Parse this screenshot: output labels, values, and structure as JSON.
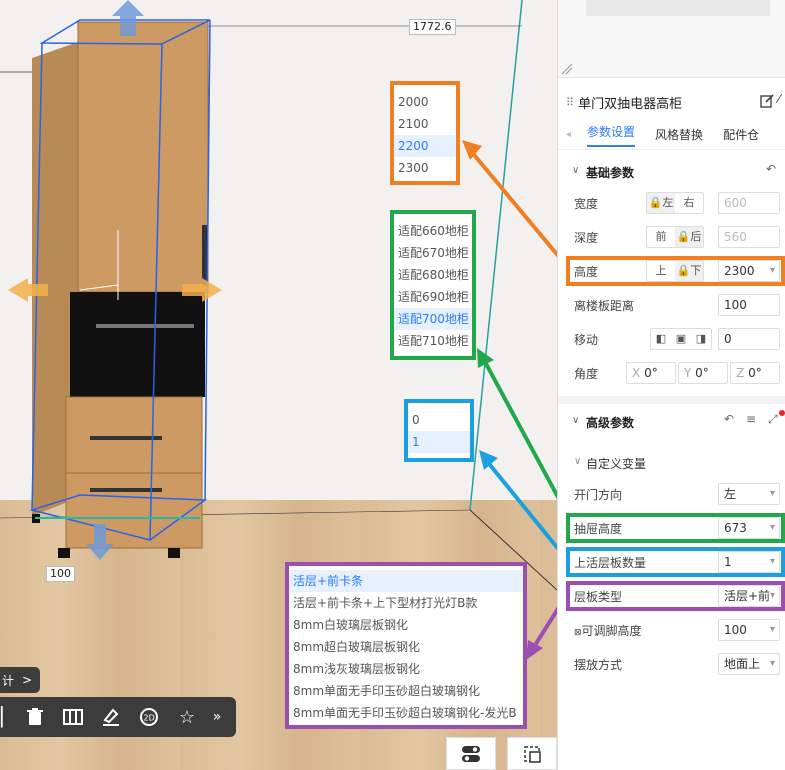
{
  "viewport": {
    "dim_top": "1772.6",
    "dim_bottom": "100"
  },
  "popups": {
    "height_options": [
      "2000",
      "2100",
      "2200",
      "2300"
    ],
    "height_selected": 2,
    "cabinet_options": [
      "适配660地柜",
      "适配670地柜",
      "适配680地柜",
      "适配690地柜",
      "适配700地柜",
      "适配710地柜"
    ],
    "cabinet_selected": 4,
    "count_options": [
      "0",
      "1"
    ],
    "count_selected": 1,
    "shelf_options": [
      "活层+前卡条",
      "活层+前卡条+上下型材打光灯B款",
      "8mm白玻璃层板钢化",
      "8mm超白玻璃层板钢化",
      "8mm浅灰玻璃层板钢化",
      "8mm单面无手印玉砂超白玻璃钢化",
      "8mm单面无手印玉砂超白玻璃钢化-发光B"
    ],
    "shelf_selected": 0
  },
  "toolbar": {
    "design_tab": "计",
    "more": "»"
  },
  "panel": {
    "title": "单门双抽电器高柜",
    "tabs": [
      "参数设置",
      "风格替换",
      "配件仓"
    ],
    "basic_title": "基础参数",
    "width_label": "宽度",
    "width_left": "左",
    "width_right": "右",
    "width_value": "600",
    "depth_label": "深度",
    "depth_front": "前",
    "depth_back": "后",
    "depth_value": "560",
    "height_label": "高度",
    "height_up": "上",
    "height_down": "下",
    "height_value": "2300",
    "floor_label": "离楼板距离",
    "floor_value": "100",
    "move_label": "移动",
    "move_value": "0",
    "angle_label": "角度",
    "angle_x": "0°",
    "angle_y": "0°",
    "angle_z": "0°",
    "angle_x_lbl": "X",
    "angle_y_lbl": "Y",
    "angle_z_lbl": "Z",
    "advanced_title": "高级参数",
    "custom_title": "自定义变量",
    "door_label": "开门方向",
    "door_value": "左",
    "drawer_label": "抽屉高度",
    "drawer_value": "673",
    "shelf_count_label": "上活层板数量",
    "shelf_count_value": "1",
    "shelf_type_label": "层板类型",
    "shelf_type_value": "活层+前",
    "foot_label": "可调脚高度",
    "foot_value": "100",
    "place_label": "摆放方式",
    "place_value": "地面上"
  },
  "colors": {
    "orange": "#f07f22",
    "green": "#22a84a",
    "blue": "#1aa0e0",
    "purple": "#9b4fae",
    "accent": "#2b7bff"
  }
}
